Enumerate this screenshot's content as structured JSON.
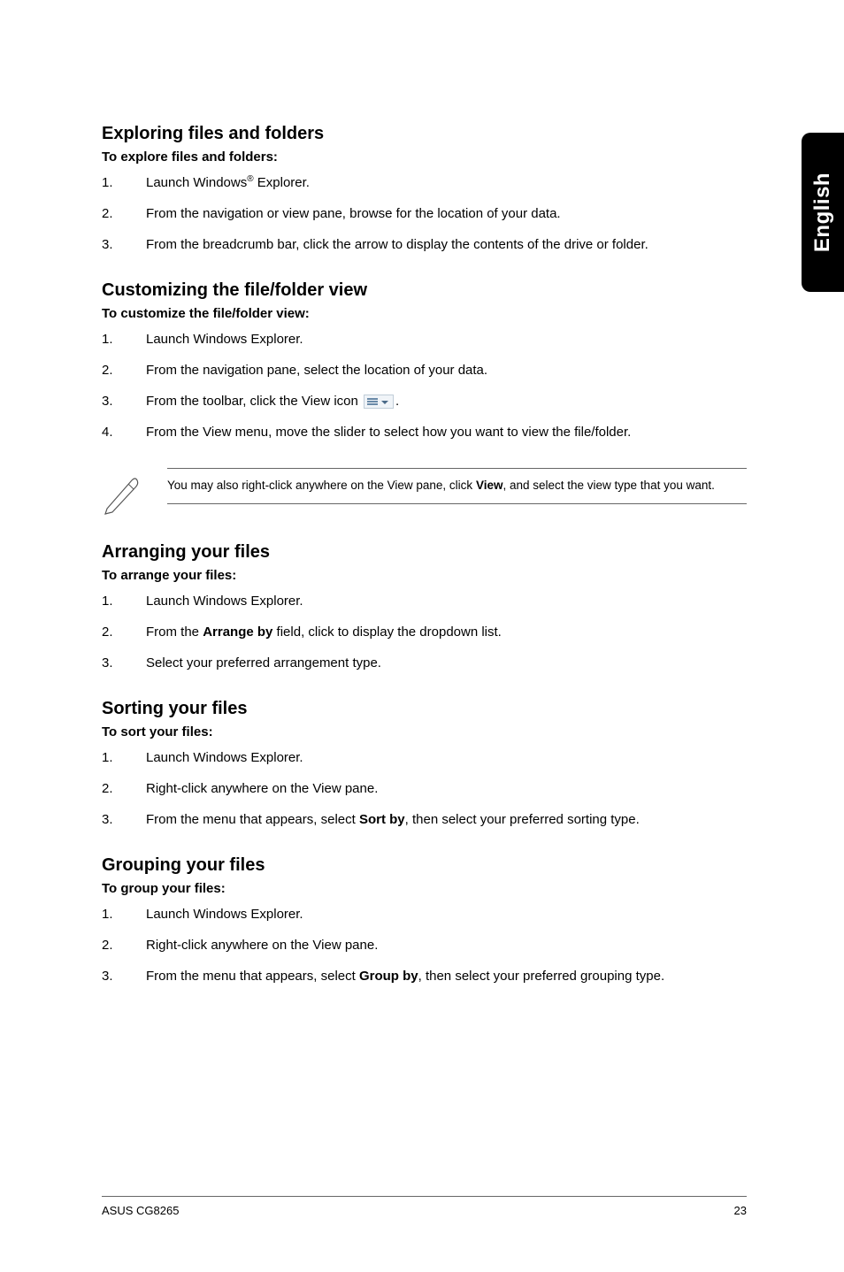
{
  "sideTab": "English",
  "sections": {
    "exploring": {
      "heading": "Exploring files and folders",
      "subhead": "To explore files and folders:",
      "items": [
        {
          "pre": "Launch Windows",
          "sup": "®",
          "post": " Explorer."
        },
        {
          "text": "From the navigation or view pane, browse for the location of your data."
        },
        {
          "text": "From the breadcrumb bar, click the arrow to display the contents of the drive or folder."
        }
      ]
    },
    "customizing": {
      "heading": "Customizing the file/folder view",
      "subhead": "To customize the file/folder view:",
      "items": [
        {
          "text": "Launch Windows Explorer."
        },
        {
          "text": "From the navigation pane, select the location of your data."
        },
        {
          "pre": "From the toolbar, click the View icon ",
          "icon": true,
          "post": "."
        },
        {
          "text": "From the View menu, move the slider to select how you want to view the file/folder."
        }
      ],
      "note": {
        "pre": "You may also right-click anywhere on the View pane, click ",
        "bold": "View",
        "post": ", and select the view type that you want."
      }
    },
    "arranging": {
      "heading": "Arranging your files",
      "subhead": "To arrange your files:",
      "items": [
        {
          "text": "Launch Windows Explorer."
        },
        {
          "pre": "From the ",
          "bold": "Arrange by",
          "post": " field, click to display the dropdown list."
        },
        {
          "text": "Select your preferred arrangement type."
        }
      ]
    },
    "sorting": {
      "heading": "Sorting your files",
      "subhead": "To sort your files:",
      "items": [
        {
          "text": "Launch Windows Explorer."
        },
        {
          "text": "Right-click anywhere on the View pane."
        },
        {
          "pre": "From the menu that appears, select ",
          "bold": "Sort by",
          "post": ", then select your preferred sorting type."
        }
      ]
    },
    "grouping": {
      "heading": "Grouping your files",
      "subhead": "To group your files:",
      "items": [
        {
          "text": "Launch Windows Explorer."
        },
        {
          "text": "Right-click anywhere on the View pane."
        },
        {
          "pre": "From the menu that appears, select ",
          "bold": "Group by",
          "post": ", then select your preferred grouping type."
        }
      ]
    }
  },
  "footer": {
    "left": "ASUS CG8265",
    "right": "23"
  }
}
